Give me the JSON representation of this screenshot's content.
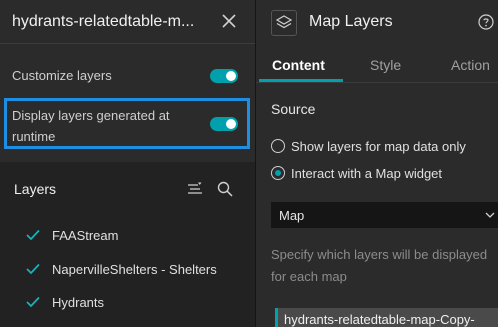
{
  "left_panel": {
    "title": "hydrants-relatedtable-m...",
    "customize_layers_label": "Customize layers",
    "runtime_label_line1": "Display layers generated at",
    "runtime_label_line2": "runtime",
    "layers_title": "Layers",
    "layers": [
      {
        "label": "FAAStream"
      },
      {
        "label": "NapervilleShelters - Shelters"
      },
      {
        "label": "Hydrants"
      }
    ]
  },
  "right_panel": {
    "title": "Map Layers",
    "tabs": [
      {
        "label": "Content",
        "active": true
      },
      {
        "label": "Style",
        "active": false
      },
      {
        "label": "Action",
        "active": false
      }
    ],
    "source_label": "Source",
    "radio_options": [
      {
        "label": "Show layers for map data only",
        "checked": false
      },
      {
        "label": "Interact with a Map widget",
        "checked": true
      }
    ],
    "map_select_value": "Map",
    "help_text": "Specify which layers will be displayed for each map",
    "map_item_label": "hydrants-relatedtable-map-Copy-"
  },
  "toggles": {
    "customize_layers": true,
    "display_runtime": true
  },
  "icons": [
    "close-icon",
    "filter-icon",
    "search-icon",
    "check-icon",
    "layers-icon",
    "help-icon",
    "chevron-down-icon"
  ],
  "colors": {
    "accent": "#00a0ac",
    "focus": "#1c8ee3",
    "panel_bg": "#2b2b2b",
    "lower_bg": "#222222",
    "input_bg": "#151515"
  }
}
